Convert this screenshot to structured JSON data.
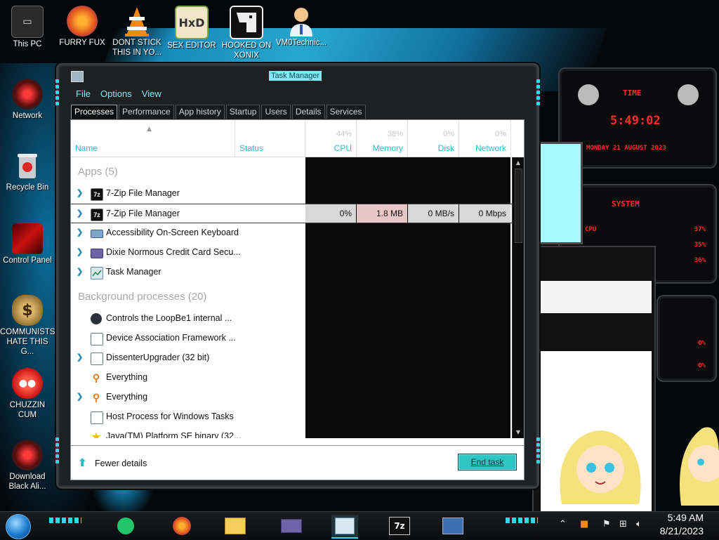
{
  "desktop": {
    "icons": [
      {
        "label": "This PC",
        "icon": "computer-icon"
      },
      {
        "label": "FURRY FUX",
        "icon": "firefox-icon"
      },
      {
        "label": "DONT STICK THIS IN YO...",
        "icon": "vlc-cone-icon"
      },
      {
        "label": "SEX EDITOR",
        "icon": "hxd-hex-editor-icon"
      },
      {
        "label": "HOOKED ON XONIX",
        "icon": "xonix-game-icon"
      },
      {
        "label": "VM0Technic...",
        "icon": "doctor-avatar-icon"
      },
      {
        "label": "Network",
        "icon": "alien-network-icon"
      },
      {
        "label": "Recycle Bin",
        "icon": "recycle-bin-icon"
      },
      {
        "label": "Control Panel",
        "icon": "control-panel-icon"
      },
      {
        "label": "COMMUNISTS HATE THIS G...",
        "icon": "money-bag-icon"
      },
      {
        "label": "CHUZZIN CUM",
        "icon": "chuzzle-icon"
      },
      {
        "label": "Download Black Ali...",
        "icon": "alien-download-icon"
      }
    ]
  },
  "gadget": {
    "time_label": "TIME",
    "time_value": "5:49:02",
    "date_value": "MONDAY 21 AUGUST 2023",
    "system_label": "SYSTEM",
    "cpu_label": "CPU",
    "readings": [
      "37%",
      "35%",
      "36%",
      "0%",
      "0%"
    ]
  },
  "window": {
    "title": "Task Manager",
    "menu": [
      "File",
      "Options",
      "View"
    ],
    "tabs": [
      "Processes",
      "Performance",
      "App history",
      "Startup",
      "Users",
      "Details",
      "Services"
    ],
    "active_tab": "Processes",
    "columns": {
      "name": "Name",
      "status": "Status",
      "cpu": {
        "label": "CPU",
        "percent": "44%"
      },
      "memory": {
        "label": "Memory",
        "percent": "38%"
      },
      "disk": {
        "label": "Disk",
        "percent": "0%"
      },
      "network": {
        "label": "Network",
        "percent": "0%"
      }
    },
    "groups": {
      "apps": "Apps (5)",
      "background": "Background processes (20)"
    },
    "apps": [
      {
        "name": "7-Zip File Manager",
        "icon": "7zip-icon",
        "expandable": true
      },
      {
        "name": "7-Zip File Manager",
        "icon": "7zip-icon",
        "expandable": true,
        "selected": true,
        "cpu": "0%",
        "memory": "1.8 MB",
        "disk": "0 MB/s",
        "network": "0 Mbps"
      },
      {
        "name": "Accessibility On-Screen Keyboard",
        "icon": "keyboard-icon",
        "expandable": true
      },
      {
        "name": "Dixie Normous Credit Card Secu...",
        "icon": "credit-card-icon",
        "expandable": true
      },
      {
        "name": "Task Manager",
        "icon": "task-manager-icon",
        "expandable": true
      }
    ],
    "background": [
      {
        "name": "Controls the LoopBe1 internal ...",
        "icon": "loopbe-icon",
        "expandable": false
      },
      {
        "name": "Device Association Framework ...",
        "icon": "generic-window-icon",
        "expandable": false
      },
      {
        "name": "DissenterUpgrader (32 bit)",
        "icon": "generic-window-icon",
        "expandable": true
      },
      {
        "name": "Everything",
        "icon": "magnifier-icon",
        "expandable": false
      },
      {
        "name": "Everything",
        "icon": "magnifier-icon",
        "expandable": true
      },
      {
        "name": "Host Process for Windows Tasks",
        "icon": "generic-window-icon",
        "expandable": false
      },
      {
        "name": "Java(TM) Platform SE binary (32...",
        "icon": "java-star-icon",
        "expandable": false
      }
    ],
    "footer": {
      "fewer_details": "Fewer details",
      "end_task": "End task"
    }
  },
  "taskbar": {
    "apps": [
      "green-chat-icon",
      "firefox-icon",
      "file-explorer-icon",
      "credit-card-app-icon",
      "task-manager-icon",
      "7zip-icon",
      "remote-desktop-icon"
    ],
    "clock_time": "5:49 AM",
    "clock_date": "8/21/2023"
  },
  "colors": {
    "accent_cyan": "#31d6e8",
    "memory_highlight": "#e9c6c8",
    "link_blue": "#36b4c8"
  }
}
